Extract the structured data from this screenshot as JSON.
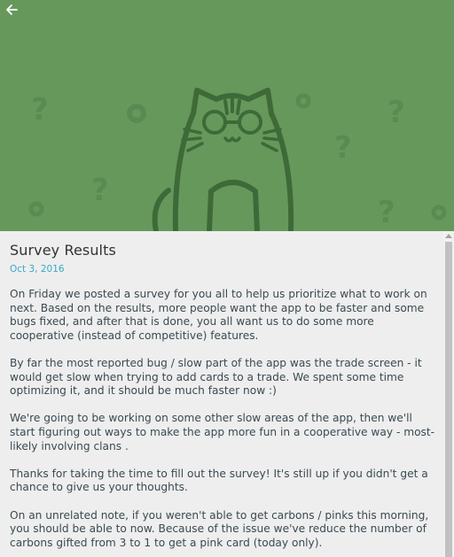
{
  "header": {
    "background_color": "#66985c",
    "back_icon": "arrow-left-icon",
    "illustration": "cat-with-glasses-and-question-marks"
  },
  "post": {
    "title": "Survey Results",
    "date": "Oct 3, 2016",
    "paragraphs": [
      "On Friday we posted a survey for you all to help us prioritize what to work on next. Based on the results, more people want the app to be faster and some bugs fixed, and after that is done, you all want us to do some more cooperative (instead of competitive) features.",
      "By far the most reported bug / slow part of the app was the trade screen - it would get slow when trying to add cards to a trade. We spent some time optimizing it, and it should be much faster now :)",
      "We're going to be working on some other slow areas of the app, then we'll start figuring out ways to make the app more fun in a cooperative way - most-likely involving clans .",
      "Thanks for taking the time to fill out the survey! It's still up if you didn't get a chance to give us your thoughts.",
      "On an unrelated note, if you weren't able to get carbons / pinks this morning, you should be able to now. Because of the issue we've reduce the number of carbons gifted from 3 to 1 to get a pink card (today only)."
    ]
  }
}
